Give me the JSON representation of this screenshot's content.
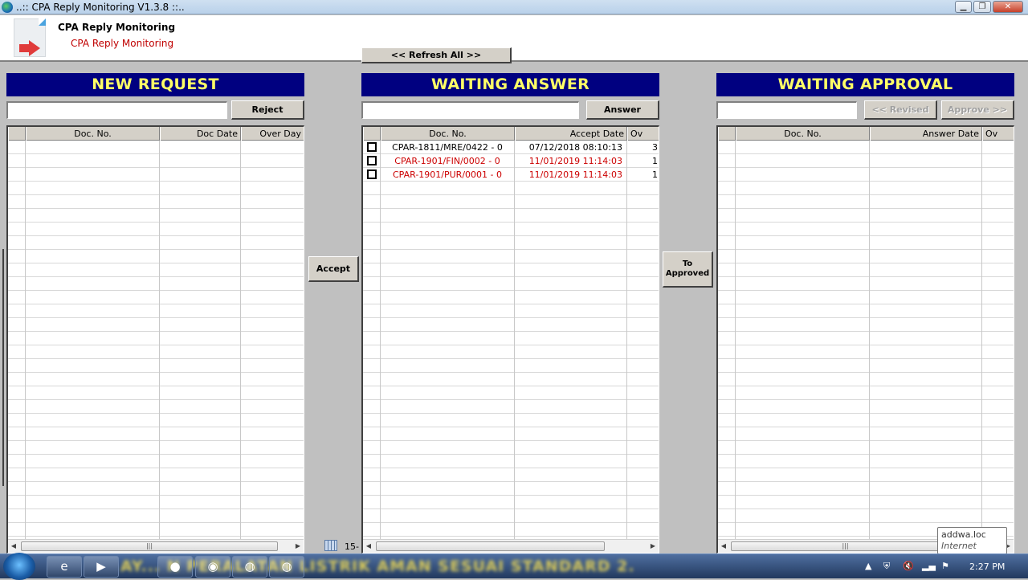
{
  "window": {
    "title": "..:: CPA Reply Monitoring V1.3.8 ::..",
    "controls": [
      "minimize",
      "maximize",
      "close"
    ]
  },
  "header": {
    "title": "CPA Reply Monitoring",
    "subtitle": "CPA Reply Monitoring",
    "refresh_label": "<< Refresh All >>"
  },
  "new_request": {
    "heading": "NEW REQUEST",
    "search_value": "",
    "reject_label": "Reject",
    "columns": [
      "Doc. No.",
      "Doc Date",
      "Over Day"
    ],
    "rows": []
  },
  "accept_label": "Accept",
  "waiting_answer": {
    "heading": "WAITING ANSWER",
    "search_value": "",
    "answer_label": "Answer",
    "columns": [
      "Doc. No.",
      "Accept Date",
      "Ov"
    ],
    "rows": [
      {
        "doc_no": "CPAR-1811/MRE/0422 - 0",
        "date": "07/12/2018 08:10:13",
        "over": "3",
        "checked": false,
        "highlight": false
      },
      {
        "doc_no": "CPAR-1901/FIN/0002 - 0",
        "date": "11/01/2019 11:14:03",
        "over": "1",
        "checked": false,
        "highlight": true
      },
      {
        "doc_no": "CPAR-1901/PUR/0001 - 0",
        "date": "11/01/2019 11:14:03",
        "over": "1",
        "checked": false,
        "highlight": true
      }
    ]
  },
  "to_approved_label": [
    "To",
    "Approved"
  ],
  "waiting_approval": {
    "heading": "WAITING APPROVAL",
    "search_value": "",
    "revised_label": "<< Revised",
    "approve_label": "Approve >>",
    "columns": [
      "Doc. No.",
      "Answer Date",
      "Ov"
    ],
    "rows": []
  },
  "status": {
    "date_fragment": "15-"
  },
  "taskbar": {
    "marquee": "AY... N PERALATAN LISTRIK AMAN SESUAI STANDARD 2.",
    "time": "2:27 PM",
    "tooltip_title": "addwa.loc",
    "tooltip_sub": "Internet access",
    "items": [
      "windows-explorer",
      "media-player",
      "firefox",
      "chrome",
      "globe-app",
      "globe-app-active"
    ]
  }
}
